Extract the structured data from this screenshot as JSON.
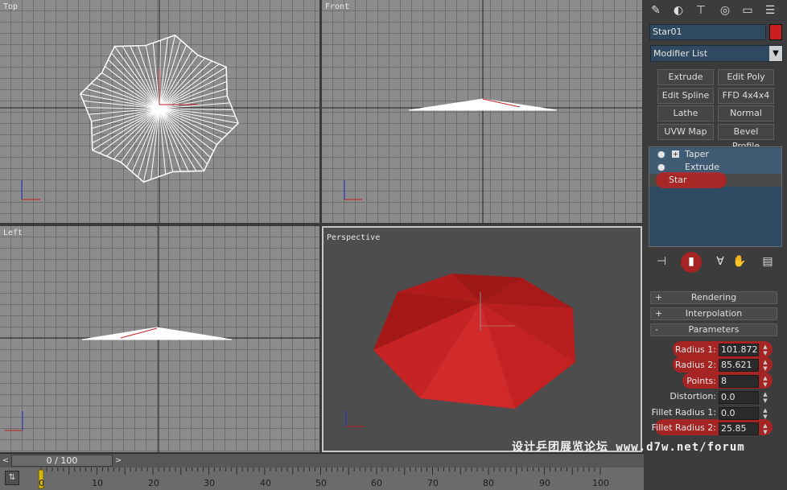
{
  "viewports": {
    "top": {
      "label": "Top"
    },
    "front": {
      "label": "Front"
    },
    "left": {
      "label": "Left"
    },
    "perspective": {
      "label": "Perspective"
    }
  },
  "command_panel": {
    "tabs": [
      {
        "icon": "create-icon"
      },
      {
        "icon": "modify-icon"
      },
      {
        "icon": "hierarchy-icon"
      },
      {
        "icon": "motion-icon"
      },
      {
        "icon": "display-icon"
      },
      {
        "icon": "utilities-icon"
      }
    ],
    "object_name": "Star01",
    "object_color": "#c81e1e",
    "modifier_list": "Modifier List",
    "modifier_buttons": [
      "Extrude",
      "Edit Poly",
      "Edit Spline",
      "FFD 4x4x4",
      "Lathe",
      "Normal",
      "UVW Map",
      "Bevel Profile"
    ],
    "stack": [
      {
        "label": "Taper",
        "selected": true
      },
      {
        "label": "Extrude",
        "selected": true
      },
      {
        "label": "Star",
        "selected": false
      }
    ],
    "rollouts": [
      {
        "sign": "+",
        "label": "Rendering"
      },
      {
        "sign": "+",
        "label": "Interpolation"
      },
      {
        "sign": "-",
        "label": "Parameters"
      }
    ],
    "parameters": [
      {
        "label": "Radius 1:",
        "value": "101.872",
        "highlight": true
      },
      {
        "label": "Radius 2:",
        "value": "85.621",
        "highlight": true
      },
      {
        "label": "Points:",
        "value": "8",
        "highlight": true
      },
      {
        "label": "Distortion:",
        "value": "0.0",
        "highlight": false
      },
      {
        "label": "Fillet Radius 1:",
        "value": "0.0",
        "highlight": false
      },
      {
        "label": "Fillet Radius 2:",
        "value": "25.85",
        "highlight": true
      }
    ]
  },
  "timeline": {
    "frame_display": "0 / 100",
    "prev": "<",
    "next": ">",
    "ticks": [
      "0",
      "10",
      "20",
      "30",
      "40",
      "50",
      "60",
      "70",
      "80",
      "90",
      "100"
    ]
  },
  "watermark": "设计乒团展览论坛 www.d7w.net/forum",
  "accent_highlight": "#c81e1e"
}
